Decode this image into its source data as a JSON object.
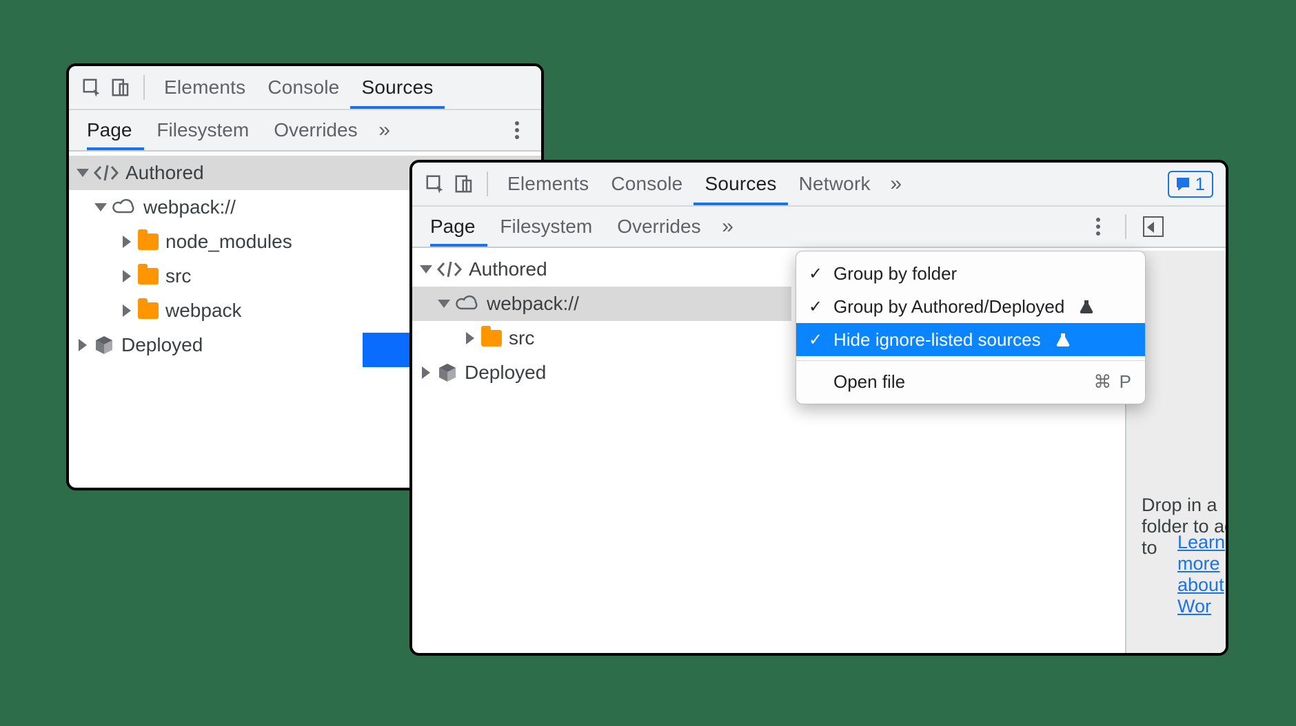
{
  "colors": {
    "accent": "#1a73e8",
    "folder": "#ff9500",
    "arrow": "#0a6cff",
    "menu_highlight": "#0a84ff"
  },
  "arrow_icon": "arrow-right-icon",
  "window1": {
    "tabbar": {
      "inspect_icon": "inspect-icon",
      "device_icon": "device-toggle-icon",
      "tabs": [
        {
          "label": "Elements",
          "active": false
        },
        {
          "label": "Console",
          "active": false
        },
        {
          "label": "Sources",
          "active": true
        }
      ]
    },
    "subtabs": {
      "items": [
        {
          "label": "Page",
          "active": true
        },
        {
          "label": "Filesystem",
          "active": false
        },
        {
          "label": "Overrides",
          "active": false
        }
      ],
      "overflow_icon": "chevron-double-right-icon",
      "kebab_icon": "kebab-menu-icon"
    },
    "tree": {
      "authored_label": "Authored",
      "webpack_label": "webpack://",
      "deployed_label": "Deployed",
      "folders": [
        {
          "label": "node_modules"
        },
        {
          "label": "src"
        },
        {
          "label": "webpack"
        }
      ]
    }
  },
  "window2": {
    "tabbar": {
      "inspect_icon": "inspect-icon",
      "device_icon": "device-toggle-icon",
      "tabs": [
        {
          "label": "Elements",
          "active": false
        },
        {
          "label": "Console",
          "active": false
        },
        {
          "label": "Sources",
          "active": true
        },
        {
          "label": "Network",
          "active": false
        }
      ],
      "overflow_icon": "chevron-double-right-icon",
      "messages_badge": {
        "icon": "messages-icon",
        "count": "1"
      }
    },
    "subtabs": {
      "items": [
        {
          "label": "Page",
          "active": true
        },
        {
          "label": "Filesystem",
          "active": false
        },
        {
          "label": "Overrides",
          "active": false
        }
      ],
      "overflow_icon": "chevron-double-right-icon",
      "kebab_icon": "kebab-menu-icon",
      "collapse_icon": "collapse-pane-icon"
    },
    "tree": {
      "authored_label": "Authored",
      "webpack_label": "webpack://",
      "deployed_label": "Deployed",
      "folders": [
        {
          "label": "src"
        }
      ]
    },
    "rightpane": {
      "hint": "Drop in a folder to add to",
      "link": "Learn more about Wor"
    },
    "menu": {
      "items": [
        {
          "label": "Group by folder",
          "checked": true,
          "flask": false,
          "highlight": false
        },
        {
          "label": "Group by Authored/Deployed",
          "checked": true,
          "flask": true,
          "highlight": false
        },
        {
          "label": "Hide ignore-listed sources",
          "checked": true,
          "flask": true,
          "highlight": true
        }
      ],
      "open_file": {
        "label": "Open file",
        "shortcut": "⌘ P"
      }
    }
  }
}
